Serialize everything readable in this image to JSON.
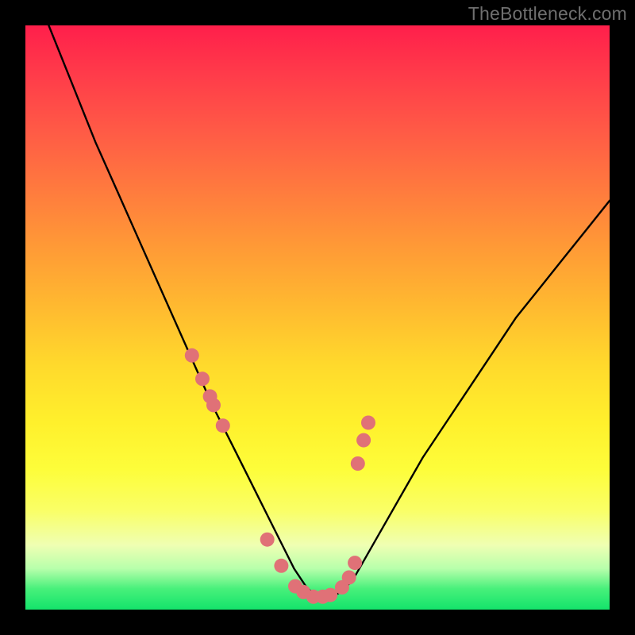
{
  "watermark": "TheBottleneck.com",
  "colors": {
    "frame": "#000000",
    "gradient_top": "#ff1f4b",
    "gradient_bottom": "#14e36b",
    "curve": "#000000",
    "dots": "#e07177"
  },
  "chart_data": {
    "type": "line",
    "title": "",
    "xlabel": "",
    "ylabel": "",
    "xlim": [
      0,
      100
    ],
    "ylim": [
      0,
      100
    ],
    "series": [
      {
        "name": "bottleneck-curve",
        "x": [
          4,
          8,
          12,
          16,
          20,
          24,
          28,
          32,
          34,
          36,
          38,
          40,
          42,
          44,
          46,
          48,
          50,
          52,
          54,
          56,
          60,
          64,
          68,
          72,
          76,
          80,
          84,
          88,
          92,
          96,
          100
        ],
        "y": [
          100,
          90,
          80,
          71,
          62,
          53,
          44,
          35,
          31,
          27,
          23,
          19,
          15,
          11,
          7,
          4,
          2,
          2,
          3,
          5,
          12,
          19,
          26,
          32,
          38,
          44,
          50,
          55,
          60,
          65,
          70
        ]
      }
    ],
    "markers": {
      "name": "highlighted-points",
      "x": [
        28.5,
        30.3,
        31.6,
        32.2,
        33.8,
        41.4,
        43.8,
        46.2,
        47.6,
        49.3,
        50.9,
        52.2,
        54.2,
        55.4,
        56.4,
        56.9,
        57.9,
        58.7
      ],
      "y": [
        43.5,
        39.5,
        36.5,
        35.0,
        31.5,
        12.0,
        7.5,
        4.0,
        3.0,
        2.2,
        2.2,
        2.5,
        3.8,
        5.5,
        8.0,
        25.0,
        29.0,
        32.0
      ]
    }
  }
}
